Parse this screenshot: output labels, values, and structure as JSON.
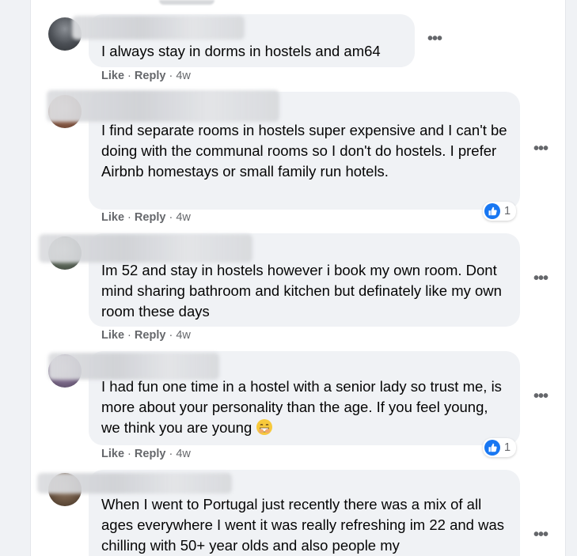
{
  "actions": {
    "like": "Like",
    "reply": "Reply",
    "sep": "·"
  },
  "comments": [
    {
      "text": "I always stay in dorms in hostels and am64",
      "time": "4w",
      "reactions": null
    },
    {
      "text": "I find separate rooms in hostels super expensive and I can't be doing with the communal rooms so I don't do hostels. I prefer Airbnb homestays or small family run hotels.",
      "time": "4w",
      "reactions": "1"
    },
    {
      "text": "Im 52 and stay in hostels however i book my own room. Dont mind sharing bathroom and kitchen but definately like my own room these days",
      "time": "4w",
      "reactions": null
    },
    {
      "text": "I had fun one time in a hostel with a senior lady so trust me, is more about your personality than the age. If you feel young, we think you are young",
      "emoji": "laughing-with-hand-over-mouth",
      "time": "4w",
      "reactions": "1"
    },
    {
      "text": "When I went to Portugal just recently there was a mix of all ages everywhere I went it was really refreshing im 22 and was chilling with 50+ year olds and also people my",
      "time": null,
      "reactions": null
    }
  ],
  "icons": {
    "more": "more-options-icon",
    "reaction": "like-reaction-icon",
    "emoji": "grinning-emoji-icon"
  },
  "colors": {
    "bubble": "#f0f2f5",
    "meta": "#65676b",
    "like_blue": "#1877f2"
  }
}
